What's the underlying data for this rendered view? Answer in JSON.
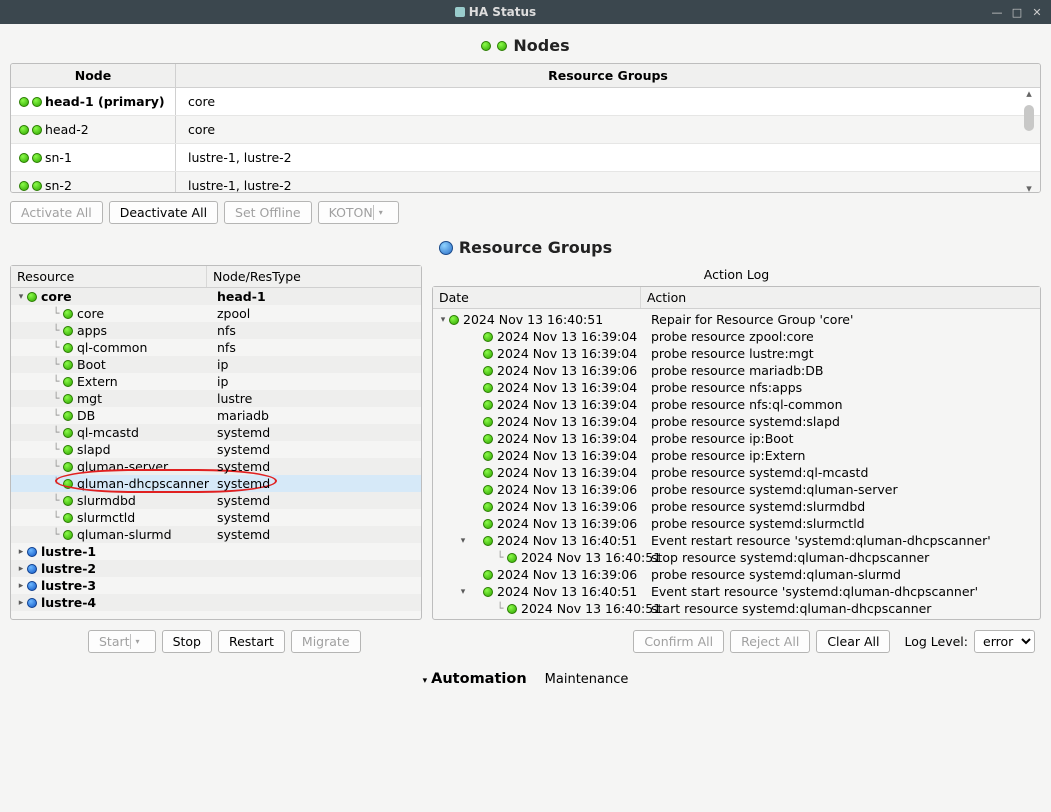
{
  "window": {
    "title": "HA Status"
  },
  "nodes": {
    "title": "Nodes",
    "columns": {
      "node": "Node",
      "rg": "Resource Groups"
    },
    "rows": [
      {
        "name": "head-1 (primary)",
        "rg": "core",
        "bold": true
      },
      {
        "name": "head-2",
        "rg": "core",
        "bold": false
      },
      {
        "name": "sn-1",
        "rg": "lustre-1, lustre-2",
        "bold": false
      },
      {
        "name": "sn-2",
        "rg": "lustre-1, lustre-2",
        "bold": false
      }
    ],
    "buttons": {
      "activate_all": "Activate All",
      "deactivate_all": "Deactivate All",
      "set_offline": "Set Offline",
      "koton": "KOTON"
    }
  },
  "rg": {
    "title": "Resource Groups",
    "left_cols": {
      "res": "Resource",
      "type": "Node/ResType"
    },
    "tree": {
      "root": {
        "name": "core",
        "type": "head-1"
      },
      "children": [
        {
          "name": "core",
          "type": "zpool"
        },
        {
          "name": "apps",
          "type": "nfs"
        },
        {
          "name": "ql-common",
          "type": "nfs"
        },
        {
          "name": "Boot",
          "type": "ip"
        },
        {
          "name": "Extern",
          "type": "ip"
        },
        {
          "name": "mgt",
          "type": "lustre"
        },
        {
          "name": "DB",
          "type": "mariadb"
        },
        {
          "name": "ql-mcastd",
          "type": "systemd"
        },
        {
          "name": "slapd",
          "type": "systemd"
        },
        {
          "name": "qluman-server",
          "type": "systemd"
        },
        {
          "name": "qluman-dhcpscanner",
          "type": "systemd",
          "selected": true
        },
        {
          "name": "slurmdbd",
          "type": "systemd"
        },
        {
          "name": "slurmctld",
          "type": "systemd"
        },
        {
          "name": "qluman-slurmd",
          "type": "systemd"
        }
      ],
      "siblings": [
        {
          "name": "lustre-1"
        },
        {
          "name": "lustre-2"
        },
        {
          "name": "lustre-3"
        },
        {
          "name": "lustre-4"
        }
      ]
    },
    "actionlog": {
      "title": "Action Log",
      "cols": {
        "date": "Date",
        "action": "Action"
      },
      "entries": [
        {
          "lvl": 0,
          "tw": "down",
          "date": "2024 Nov 13 16:40:51",
          "action": "Repair for Resource Group 'core'"
        },
        {
          "lvl": 1,
          "tw": "",
          "date": "2024 Nov 13 16:39:04",
          "action": "probe resource zpool:core"
        },
        {
          "lvl": 1,
          "tw": "",
          "date": "2024 Nov 13 16:39:04",
          "action": "probe resource lustre:mgt"
        },
        {
          "lvl": 1,
          "tw": "",
          "date": "2024 Nov 13 16:39:06",
          "action": "probe resource mariadb:DB"
        },
        {
          "lvl": 1,
          "tw": "",
          "date": "2024 Nov 13 16:39:04",
          "action": "probe resource nfs:apps"
        },
        {
          "lvl": 1,
          "tw": "",
          "date": "2024 Nov 13 16:39:04",
          "action": "probe resource nfs:ql-common"
        },
        {
          "lvl": 1,
          "tw": "",
          "date": "2024 Nov 13 16:39:04",
          "action": "probe resource systemd:slapd"
        },
        {
          "lvl": 1,
          "tw": "",
          "date": "2024 Nov 13 16:39:04",
          "action": "probe resource ip:Boot"
        },
        {
          "lvl": 1,
          "tw": "",
          "date": "2024 Nov 13 16:39:04",
          "action": "probe resource ip:Extern"
        },
        {
          "lvl": 1,
          "tw": "",
          "date": "2024 Nov 13 16:39:04",
          "action": "probe resource systemd:ql-mcastd"
        },
        {
          "lvl": 1,
          "tw": "",
          "date": "2024 Nov 13 16:39:06",
          "action": "probe resource systemd:qluman-server"
        },
        {
          "lvl": 1,
          "tw": "",
          "date": "2024 Nov 13 16:39:06",
          "action": "probe resource systemd:slurmdbd"
        },
        {
          "lvl": 1,
          "tw": "",
          "date": "2024 Nov 13 16:39:06",
          "action": "probe resource systemd:slurmctld"
        },
        {
          "lvl": 1,
          "tw": "down",
          "date": "2024 Nov 13 16:40:51",
          "action": "Event restart resource 'systemd:qluman-dhcpscanner'"
        },
        {
          "lvl": 2,
          "tw": "",
          "date": "2024 Nov 13 16:40:51",
          "action": "stop resource systemd:qluman-dhcpscanner"
        },
        {
          "lvl": 1,
          "tw": "",
          "date": "2024 Nov 13 16:39:06",
          "action": "probe resource systemd:qluman-slurmd"
        },
        {
          "lvl": 1,
          "tw": "down",
          "date": "2024 Nov 13 16:40:51",
          "action": "Event start resource 'systemd:qluman-dhcpscanner'"
        },
        {
          "lvl": 2,
          "tw": "",
          "date": "2024 Nov 13 16:40:51",
          "action": "start resource systemd:qluman-dhcpscanner"
        }
      ]
    },
    "res_buttons": {
      "start": "Start",
      "stop": "Stop",
      "restart": "Restart",
      "migrate": "Migrate"
    },
    "log_buttons": {
      "confirm_all": "Confirm All",
      "reject_all": "Reject All",
      "clear_all": "Clear All",
      "loglevel_label": "Log Level:",
      "loglevel_value": "error"
    }
  },
  "footer": {
    "automation": "Automation",
    "maintenance": "Maintenance"
  }
}
